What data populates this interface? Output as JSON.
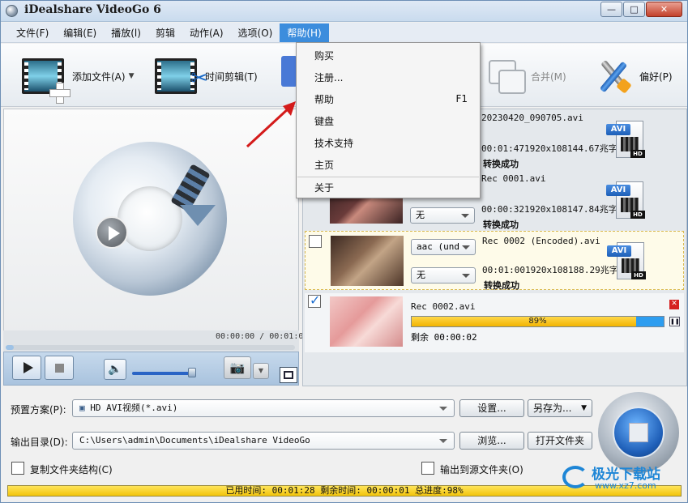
{
  "window": {
    "title": "iDealshare VideoGo 6",
    "controls": {
      "minimize": "—",
      "maximize": "□",
      "close": "✕"
    }
  },
  "menubar": {
    "items": [
      "文件(F)",
      "编辑(E)",
      "播放(l)",
      "剪辑",
      "动作(A)",
      "选项(O)",
      "帮助(H)"
    ],
    "active_index": 6
  },
  "toolbar": {
    "add_file": "添加文件(A)",
    "trim": "时间剪辑(T)",
    "merge": "合并(M)",
    "preferences": "偏好(P)"
  },
  "help_menu": {
    "items": [
      {
        "label": "购买",
        "shortcut": ""
      },
      {
        "label": "注册...",
        "shortcut": ""
      },
      {
        "label": "帮助",
        "shortcut": "F1"
      },
      {
        "label": "键盘",
        "shortcut": ""
      },
      {
        "label": "技术支持",
        "shortcut": ""
      },
      {
        "label": "主页",
        "shortcut": ""
      },
      {
        "label": "关于",
        "shortcut": ""
      }
    ]
  },
  "preview": {
    "timecode": "00:00:00 / 00:01:00"
  },
  "files": [
    {
      "name": "20230420_090705.avi",
      "meta": "00:01:471920x108144.67兆字",
      "status": "转换成功",
      "format": "AVI"
    },
    {
      "name": "Rec 0001.avi",
      "meta": "00:00:321920x108147.84兆字",
      "status": "转换成功",
      "subtitle": "无",
      "format": "AVI"
    },
    {
      "name": "Rec 0002 (Encoded).avi",
      "meta": "00:01:001920x108188.29兆字",
      "status": "转换成功",
      "audio": "aac (und",
      "subtitle": "无",
      "format": "AVI"
    },
    {
      "name": "Rec 0002.avi",
      "progress_percent": 89,
      "progress_label": "89%",
      "remaining": "剩余 00:00:02"
    }
  ],
  "bottom": {
    "preset_label": "预置方案(P):",
    "preset_value": "HD AVI视频(*.avi)",
    "settings_btn": "设置...",
    "save_as_btn": "另存为...",
    "output_label": "输出目录(D):",
    "output_value": "C:\\Users\\admin\\Documents\\iDealshare VideoGo",
    "browse_btn": "浏览...",
    "open_folder_btn": "打开文件夹",
    "copy_structure": "复制文件夹结构(C)",
    "output_to_source": "输出到源文件夹(O)"
  },
  "status": {
    "text": "已用时间: 00:01:28 剩余时间: 00:00:01 总进度:98%",
    "percent": 98
  },
  "watermark": {
    "text": "极光下载站",
    "sub": "www.xz7.com"
  },
  "colors": {
    "menu_active": "#3c8ddd",
    "progress_yellow": "#f2b300",
    "progress_blue": "#2d9df0",
    "accent_blue": "#1e86d6"
  }
}
